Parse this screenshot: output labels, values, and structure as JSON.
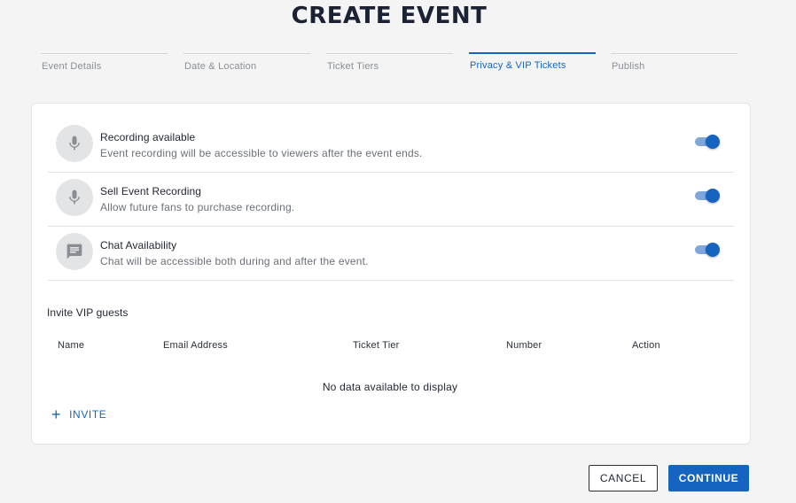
{
  "page": {
    "title": "CREATE EVENT"
  },
  "steps": [
    {
      "label": "Event Details",
      "active": false
    },
    {
      "label": "Date & Location",
      "active": false
    },
    {
      "label": "Ticket Tiers",
      "active": false
    },
    {
      "label": "Privacy & VIP Tickets",
      "active": true
    },
    {
      "label": "Publish",
      "active": false
    }
  ],
  "options": [
    {
      "title": "Recording available",
      "description": "Event recording will be accessible to viewers after the event ends.",
      "icon": "microphone-icon",
      "enabled": true
    },
    {
      "title": "Sell Event Recording",
      "description": "Allow future fans to purchase recording.",
      "icon": "microphone-icon",
      "enabled": true
    },
    {
      "title": "Chat Availability",
      "description": "Chat will be accessible both during and after the event.",
      "icon": "chat-icon",
      "enabled": true
    }
  ],
  "vip": {
    "title": "Invite VIP guests",
    "columns": [
      "Name",
      "Email Address",
      "Ticket Tier",
      "Number",
      "Action"
    ],
    "empty_text": "No data available to display",
    "invite_label": "INVITE"
  },
  "footer": {
    "cancel_label": "CANCEL",
    "continue_label": "CONTINUE"
  },
  "colors": {
    "accent": "#1565c0",
    "toggle_track": "#7fa6dd",
    "background": "#f4f4f4"
  }
}
